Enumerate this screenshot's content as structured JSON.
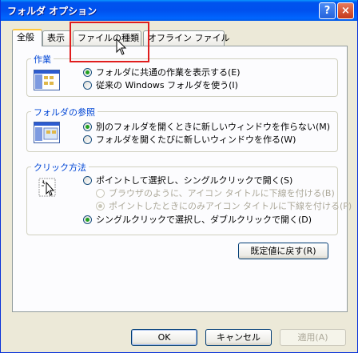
{
  "window": {
    "title": "フォルダ オプション",
    "help_label": "?",
    "close_label": "×"
  },
  "tabs": [
    {
      "label": "全般",
      "active": true
    },
    {
      "label": "表示",
      "active": false
    },
    {
      "label": "ファイルの種類",
      "active": false
    },
    {
      "label": "オフライン ファイル",
      "active": false
    }
  ],
  "groups": {
    "tasks": {
      "title": "作業",
      "options": [
        {
          "label": "フォルダに共通の作業を表示する(E)",
          "checked": true
        },
        {
          "label": "従来の Windows フォルダを使う(I)",
          "checked": false
        }
      ]
    },
    "browse": {
      "title": "フォルダの参照",
      "options": [
        {
          "label": "別のフォルダを開くときに新しいウィンドウを作らない(M)",
          "checked": true
        },
        {
          "label": "フォルダを開くたびに新しいウィンドウを作る(W)",
          "checked": false
        }
      ]
    },
    "click": {
      "title": "クリック方法",
      "options": [
        {
          "label": "ポイントして選択し、シングルクリックで開く(S)",
          "checked": false
        },
        {
          "label": "ブラウザのように、アイコン タイトルに下線を付ける(B)",
          "checked": false,
          "disabled": true
        },
        {
          "label": "ポイントしたときにのみアイコン タイトルに下線を付ける(P)",
          "checked": true,
          "disabled": true
        },
        {
          "label": "シングルクリックで選択し、ダブルクリックで開く(D)",
          "checked": true
        }
      ]
    }
  },
  "restore_defaults_label": "既定値に戻す(R)",
  "footer": {
    "ok_label": "OK",
    "cancel_label": "キャンセル",
    "apply_label": "適用(A)"
  }
}
